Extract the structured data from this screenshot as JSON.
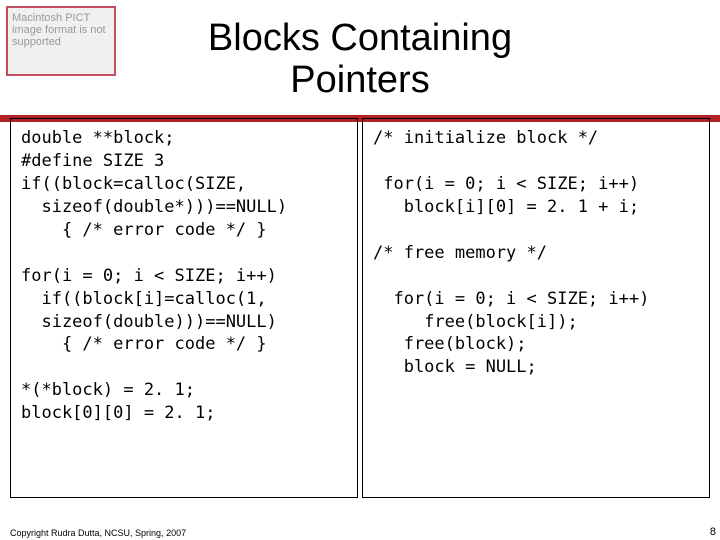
{
  "thumbnail": {
    "placeholder": "Macintosh PICT image format is not supported"
  },
  "title": "Blocks Containing\nPointers",
  "left_code": "double **block;\n#define SIZE 3\nif((block=calloc(SIZE,\n  sizeof(double*)))==NULL)\n    { /* error code */ }\n\nfor(i = 0; i < SIZE; i++)\n  if((block[i]=calloc(1,\n  sizeof(double)))==NULL)\n    { /* error code */ }\n\n*(*block) = 2. 1;\nblock[0][0] = 2. 1;",
  "right_code": "/* initialize block */\n\n for(i = 0; i < SIZE; i++)\n   block[i][0] = 2. 1 + i;\n\n/* free memory */\n\n  for(i = 0; i < SIZE; i++)\n     free(block[i]);\n   free(block);\n   block = NULL;",
  "copyright": "Copyright Rudra Dutta, NCSU, Spring, 2007",
  "page_number": "8"
}
